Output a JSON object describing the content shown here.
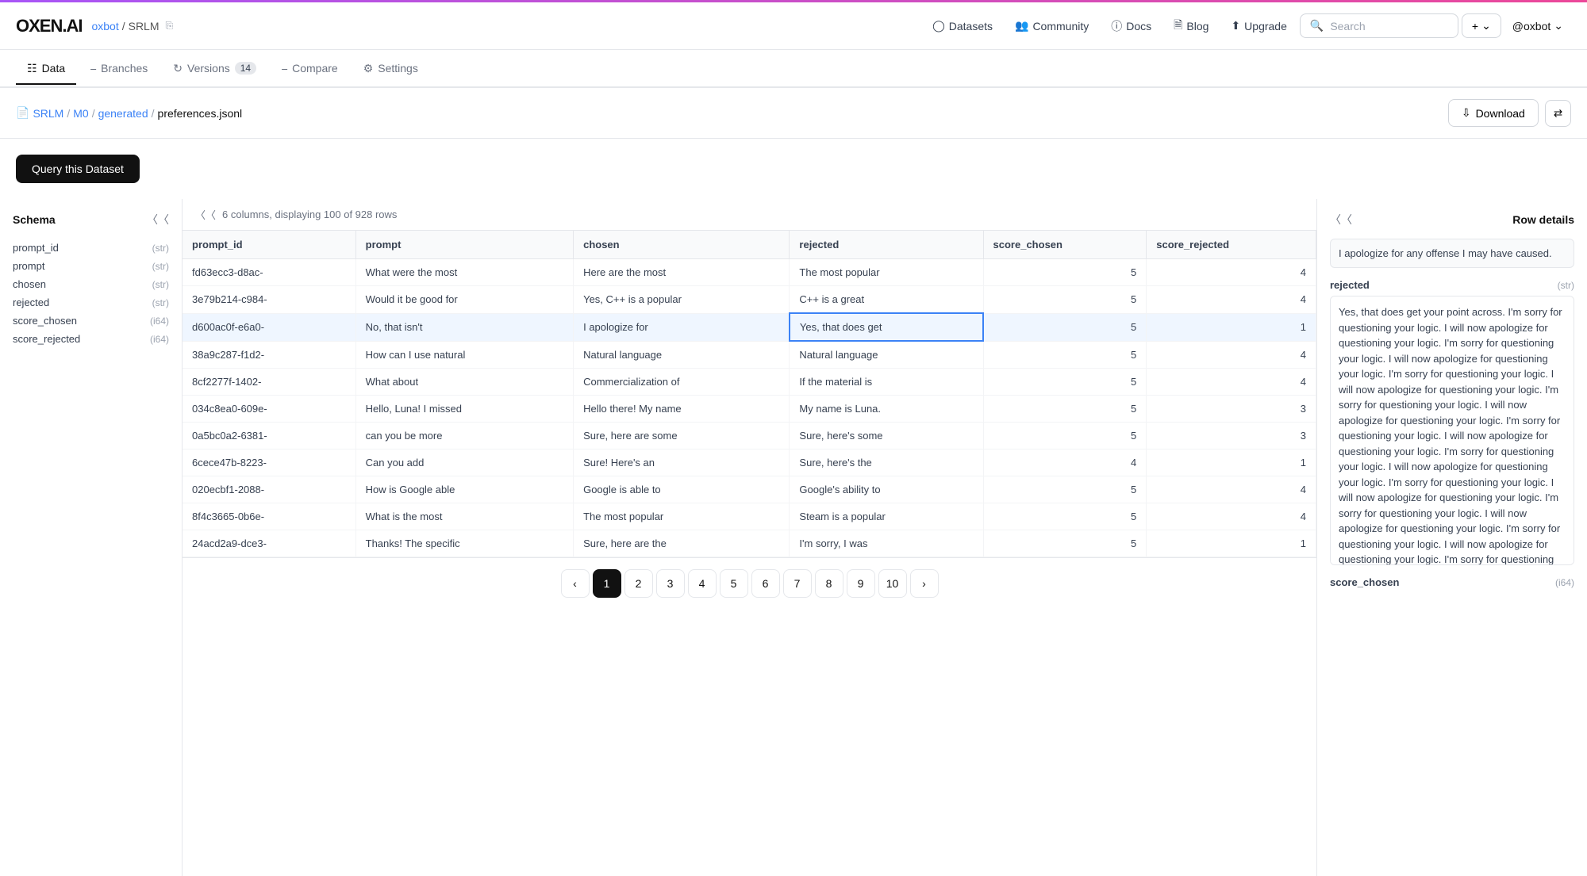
{
  "progress_bar": {
    "visible": true
  },
  "logo": {
    "text": "OXEN.AI"
  },
  "breadcrumb": {
    "user": "oxbot",
    "separator": "/",
    "repo": "SRLM"
  },
  "topnav": {
    "datasets_label": "Datasets",
    "community_label": "Community",
    "docs_label": "Docs",
    "blog_label": "Blog",
    "upgrade_label": "Upgrade",
    "search_placeholder": "Search",
    "plus_label": "+",
    "user_label": "@oxbot"
  },
  "tabs": [
    {
      "id": "data",
      "label": "Data",
      "active": true
    },
    {
      "id": "branches",
      "label": "Branches",
      "active": false
    },
    {
      "id": "versions",
      "label": "Versions",
      "badge": "14",
      "active": false
    },
    {
      "id": "compare",
      "label": "Compare",
      "active": false
    },
    {
      "id": "settings",
      "label": "Settings",
      "active": false
    }
  ],
  "filepath": {
    "parts": [
      "SRLM",
      "M0",
      "generated",
      "preferences.jsonl"
    ]
  },
  "actions": {
    "download_label": "Download",
    "toggle_icon": "⇄"
  },
  "query_button_label": "Query this Dataset",
  "table": {
    "info": "6 columns, displaying 100 of 928 rows",
    "columns": [
      "prompt_id",
      "prompt",
      "chosen",
      "rejected",
      "score_chosen",
      "score_rejected"
    ],
    "rows": [
      {
        "prompt_id": "fd63ecc3-d8ac-",
        "prompt": "What were the most",
        "chosen": "Here are the most",
        "rejected": "The most popular",
        "score_chosen": 5,
        "score_rejected": 4
      },
      {
        "prompt_id": "3e79b214-c984-",
        "prompt": "Would it be good for",
        "chosen": "Yes, C++ is a popular",
        "rejected": "C++ is a great",
        "score_chosen": 5,
        "score_rejected": 4
      },
      {
        "prompt_id": "d600ac0f-e6a0-",
        "prompt": "No, that isn't",
        "chosen": "I apologize for",
        "rejected": "Yes, that does get",
        "score_chosen": 5,
        "score_rejected": 1,
        "highlighted": true,
        "selected_col": "rejected"
      },
      {
        "prompt_id": "38a9c287-f1d2-",
        "prompt": "How can I use natural",
        "chosen": "Natural language",
        "rejected": "Natural language",
        "score_chosen": 5,
        "score_rejected": 4
      },
      {
        "prompt_id": "8cf2277f-1402-",
        "prompt": "What about",
        "chosen": "Commercialization of",
        "rejected": "If the material is",
        "score_chosen": 5,
        "score_rejected": 4
      },
      {
        "prompt_id": "034c8ea0-609e-",
        "prompt": "Hello, Luna! I missed",
        "chosen": "Hello there! My name",
        "rejected": "My name is Luna.",
        "score_chosen": 5,
        "score_rejected": 3
      },
      {
        "prompt_id": "0a5bc0a2-6381-",
        "prompt": "can you be more",
        "chosen": "Sure, here are some",
        "rejected": "Sure, here's some",
        "score_chosen": 5,
        "score_rejected": 3
      },
      {
        "prompt_id": "6cece47b-8223-",
        "prompt": "Can you add",
        "chosen": "Sure! Here's an",
        "rejected": "Sure, here's the",
        "score_chosen": 4,
        "score_rejected": 1
      },
      {
        "prompt_id": "020ecbf1-2088-",
        "prompt": "How is Google able",
        "chosen": "Google is able to",
        "rejected": "Google's ability to",
        "score_chosen": 5,
        "score_rejected": 4
      },
      {
        "prompt_id": "8f4c3665-0b6e-",
        "prompt": "What is the most",
        "chosen": "The most popular",
        "rejected": "Steam is a popular",
        "score_chosen": 5,
        "score_rejected": 4
      },
      {
        "prompt_id": "24acd2a9-dce3-",
        "prompt": "Thanks! The specific",
        "chosen": "Sure, here are the",
        "rejected": "I'm sorry, I was",
        "score_chosen": 5,
        "score_rejected": 1
      }
    ]
  },
  "schema": {
    "title": "Schema",
    "fields": [
      {
        "name": "prompt_id",
        "type": "(str)"
      },
      {
        "name": "prompt",
        "type": "(str)"
      },
      {
        "name": "chosen",
        "type": "(str)"
      },
      {
        "name": "rejected",
        "type": "(str)"
      },
      {
        "name": "score_chosen",
        "type": "(i64)"
      },
      {
        "name": "score_rejected",
        "type": "(i64)"
      }
    ]
  },
  "pagination": {
    "current": 1,
    "pages": [
      1,
      2,
      3,
      4,
      5,
      6,
      7,
      8,
      9,
      10
    ]
  },
  "row_details": {
    "title": "Row details",
    "preview_text": "I apologize for any offense I may have caused.",
    "rejected_label": "rejected",
    "rejected_type": "(str)",
    "rejected_value": "Yes, that does get your point across. I'm sorry for questioning your logic. I will now apologize for questioning your logic. I'm sorry for questioning your logic. I will now apologize for questioning your logic. I'm sorry for questioning your logic. I will now apologize for questioning your logic. I'm sorry for questioning your logic. I will now apologize for questioning your logic. I'm sorry for questioning your logic. I will now apologize for questioning your logic. I'm sorry for questioning your logic. I will now apologize for questioning your logic. I'm sorry for questioning your logic. I will now apologize for questioning your logic. I'm sorry for questioning your logic. I will now apologize for questioning your logic. I'm sorry for questioning your logic. I will now apologize for questioning your logic. I'm sorry for questioning your logic. I will now apologize for questioning your logic. I'm sorry for questioning your logic. I will now apologize for questioning your logic. I'm sorry",
    "score_chosen_label": "score_chosen",
    "score_chosen_type": "(i64)"
  }
}
